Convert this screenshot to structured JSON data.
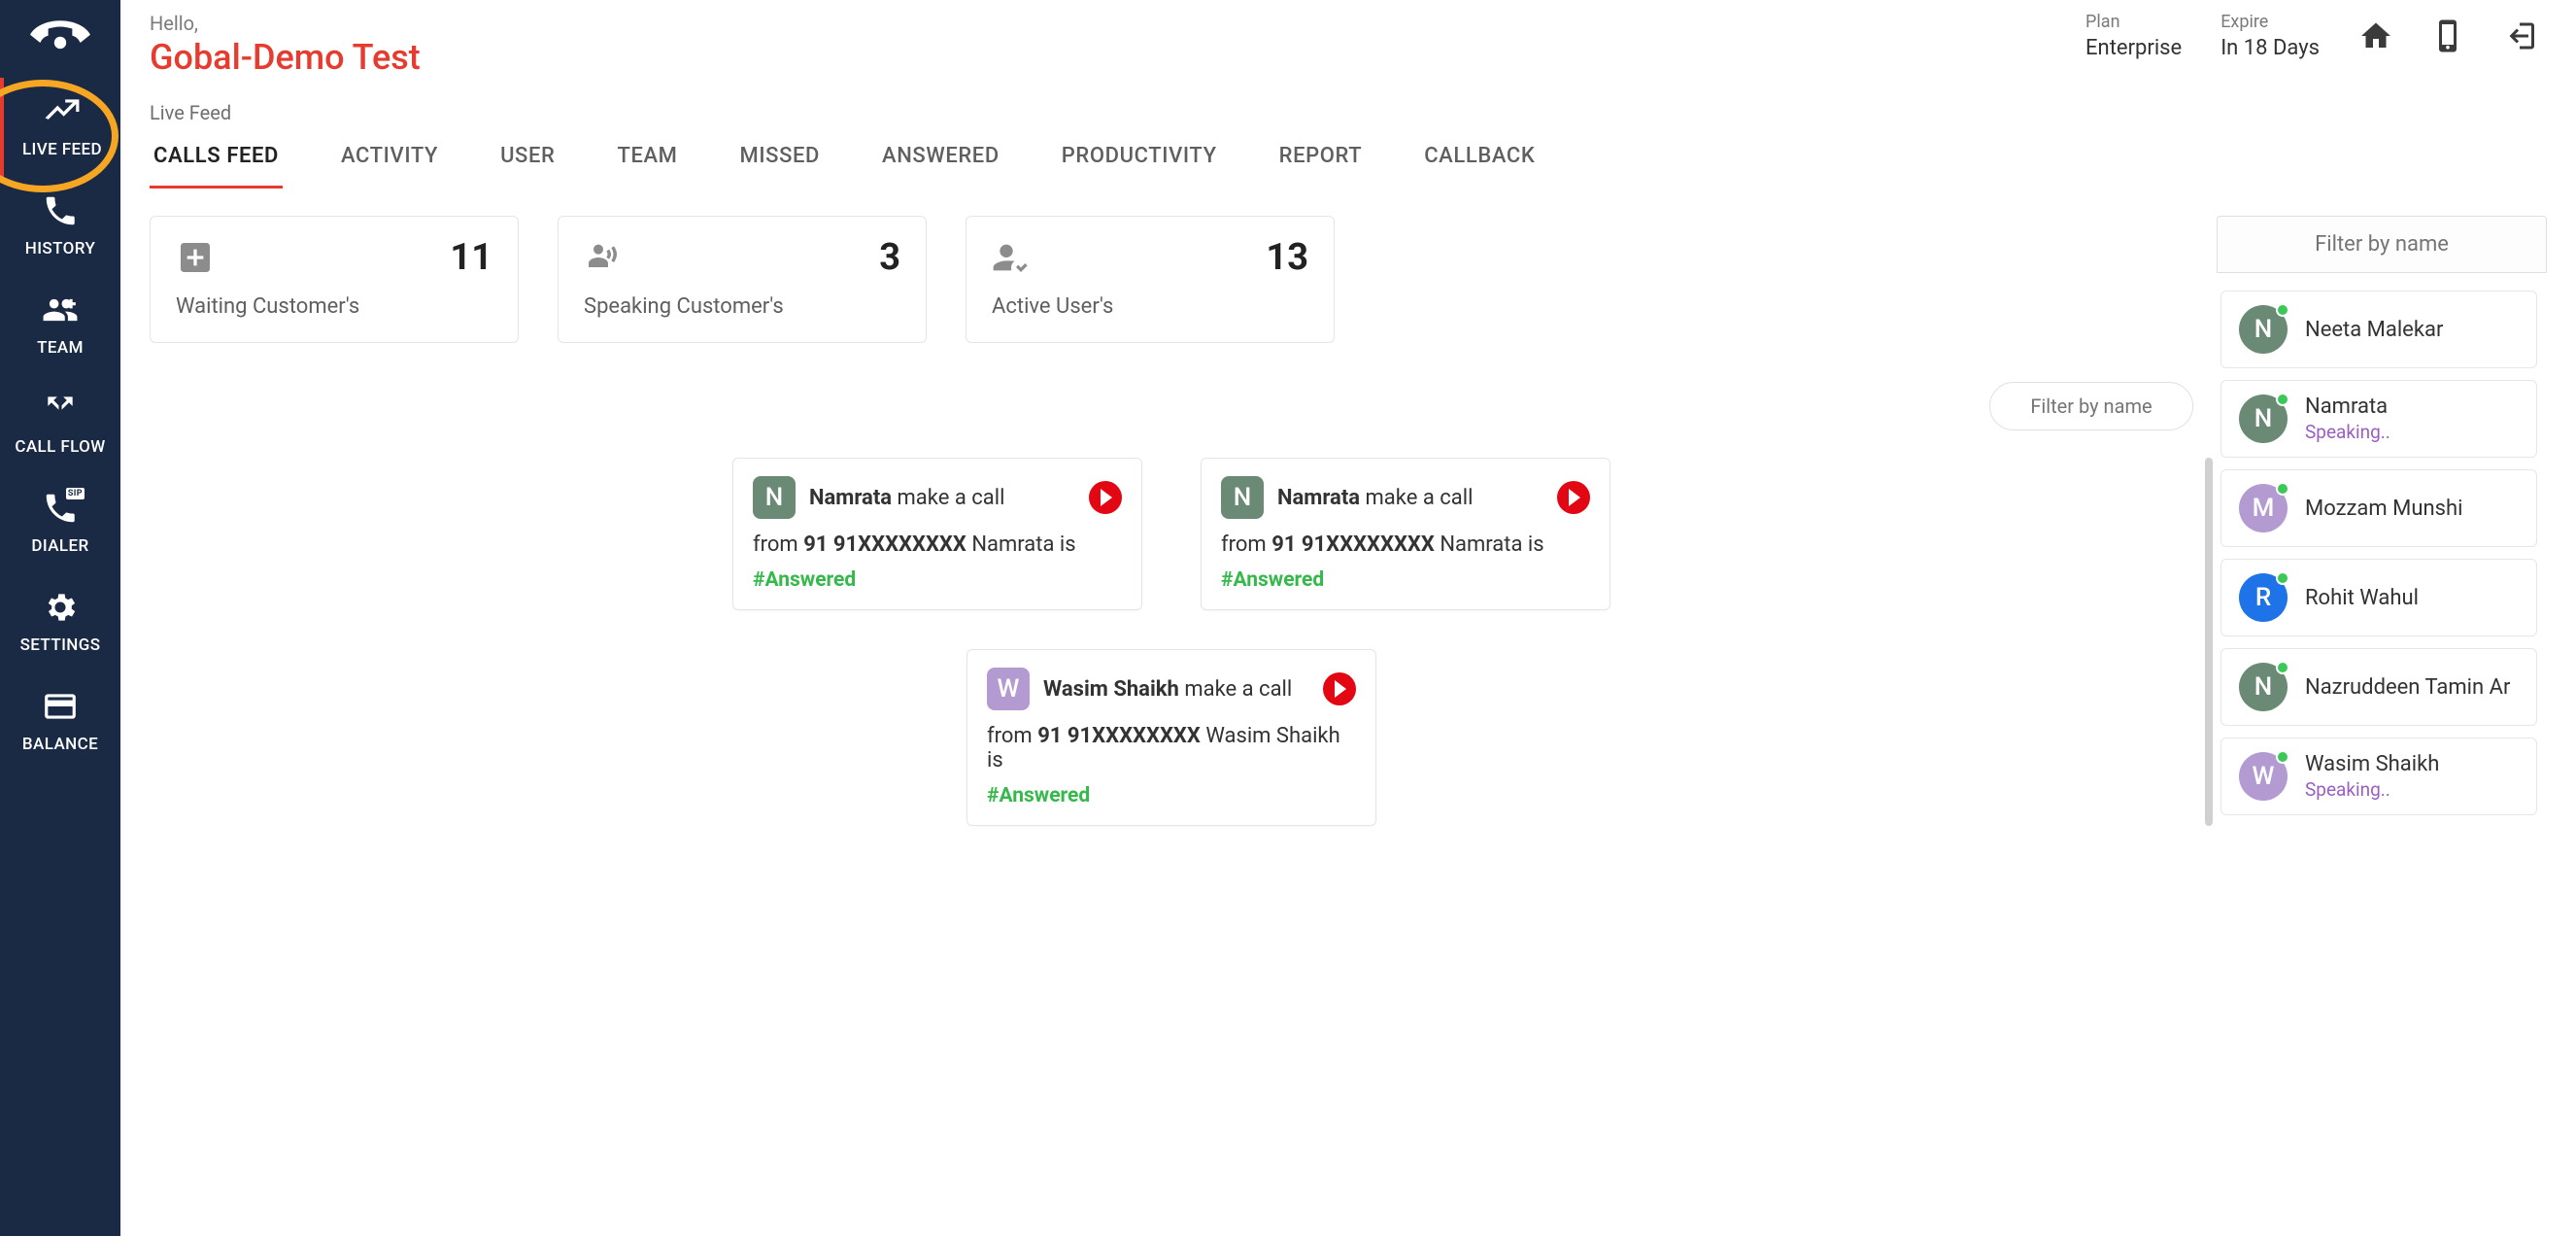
{
  "sidebar": {
    "items": [
      {
        "label": "LIVE FEED"
      },
      {
        "label": "HISTORY"
      },
      {
        "label": "TEAM"
      },
      {
        "label": "CALL FLOW"
      },
      {
        "label": "DIALER"
      },
      {
        "label": "SETTINGS"
      },
      {
        "label": "BALANCE"
      }
    ]
  },
  "header": {
    "greeting": "Hello,",
    "username": "Gobal-Demo Test",
    "plan_label": "Plan",
    "plan_value": "Enterprise",
    "expire_label": "Expire",
    "expire_value": "In 18 Days"
  },
  "breadcrumb": "Live Feed",
  "tabs": [
    "CALLS FEED",
    "ACTIVITY",
    "USER",
    "TEAM",
    "MISSED",
    "ANSWERED",
    "PRODUCTIVITY",
    "REPORT",
    "CALLBACK"
  ],
  "stats": [
    {
      "value": "11",
      "label": "Waiting Customer's"
    },
    {
      "value": "3",
      "label": "Speaking Customer's"
    },
    {
      "value": "13",
      "label": "Active User's"
    }
  ],
  "feed_filter_placeholder": "Filter by name",
  "feed": [
    {
      "initial": "N",
      "color": "c-green",
      "name": "Namrata",
      "action": "make a call",
      "from_prefix": "from ",
      "number": "91 91XXXXXXXX",
      "name_trail": "Namrata is",
      "status": "#Answered"
    },
    {
      "initial": "N",
      "color": "c-green",
      "name": "Namrata",
      "action": "make a call",
      "from_prefix": "from ",
      "number": "91 91XXXXXXXX",
      "name_trail": "Namrata is",
      "status": "#Answered"
    },
    {
      "initial": "W",
      "color": "c-purple",
      "name": "Wasim Shaikh",
      "action": "make a call",
      "from_prefix": "from ",
      "number": "91 91XXXXXXXX",
      "name_trail": "Wasim Shaikh is",
      "status": "#Answered"
    }
  ],
  "right": {
    "filter_placeholder": "Filter by name",
    "users": [
      {
        "initial": "N",
        "color": "c-green",
        "name": "Neeta Malekar",
        "status": ""
      },
      {
        "initial": "N",
        "color": "c-green",
        "name": "Namrata",
        "status": "Speaking.."
      },
      {
        "initial": "M",
        "color": "c-purple",
        "name": "Mozzam Munshi",
        "status": ""
      },
      {
        "initial": "R",
        "color": "c-blue",
        "name": "Rohit Wahul",
        "status": ""
      },
      {
        "initial": "N",
        "color": "c-green",
        "name": "Nazruddeen Tamin Ar",
        "status": ""
      },
      {
        "initial": "W",
        "color": "c-purple",
        "name": "Wasim Shaikh",
        "status": "Speaking.."
      }
    ]
  }
}
